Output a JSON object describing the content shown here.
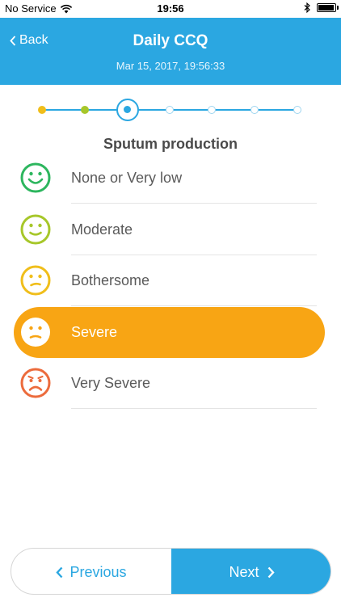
{
  "status_bar": {
    "carrier": "No Service",
    "time": "19:56",
    "wifi_icon": "wifi-icon",
    "bluetooth_icon": "bluetooth-icon",
    "battery_icon": "battery-icon"
  },
  "header": {
    "back_label": "Back",
    "title": "Daily CCQ",
    "subtitle": "Mar 15, 2017, 19:56:33",
    "color": "#2ba7e1"
  },
  "stepper": {
    "total_steps": 7,
    "current_step": 3,
    "completed_colors": [
      "#f0be1b",
      "#a7c72a"
    ],
    "accent": "#2ba7e1"
  },
  "question": {
    "title": "Sputum production"
  },
  "options": [
    {
      "label": "None or Very low",
      "icon": "very-happy-face-icon",
      "color": "#2db65e",
      "selected": false
    },
    {
      "label": "Moderate",
      "icon": "happy-face-icon",
      "color": "#a7c72a",
      "selected": false
    },
    {
      "label": "Bothersome",
      "icon": "neutral-face-icon",
      "color": "#f0be1b",
      "selected": false
    },
    {
      "label": "Severe",
      "icon": "sad-face-icon",
      "color": "#f8a514",
      "selected": true
    },
    {
      "label": "Very Severe",
      "icon": "very-sad-face-icon",
      "color": "#ec6b3c",
      "selected": false
    }
  ],
  "navigation": {
    "previous_label": "Previous",
    "next_label": "Next"
  }
}
